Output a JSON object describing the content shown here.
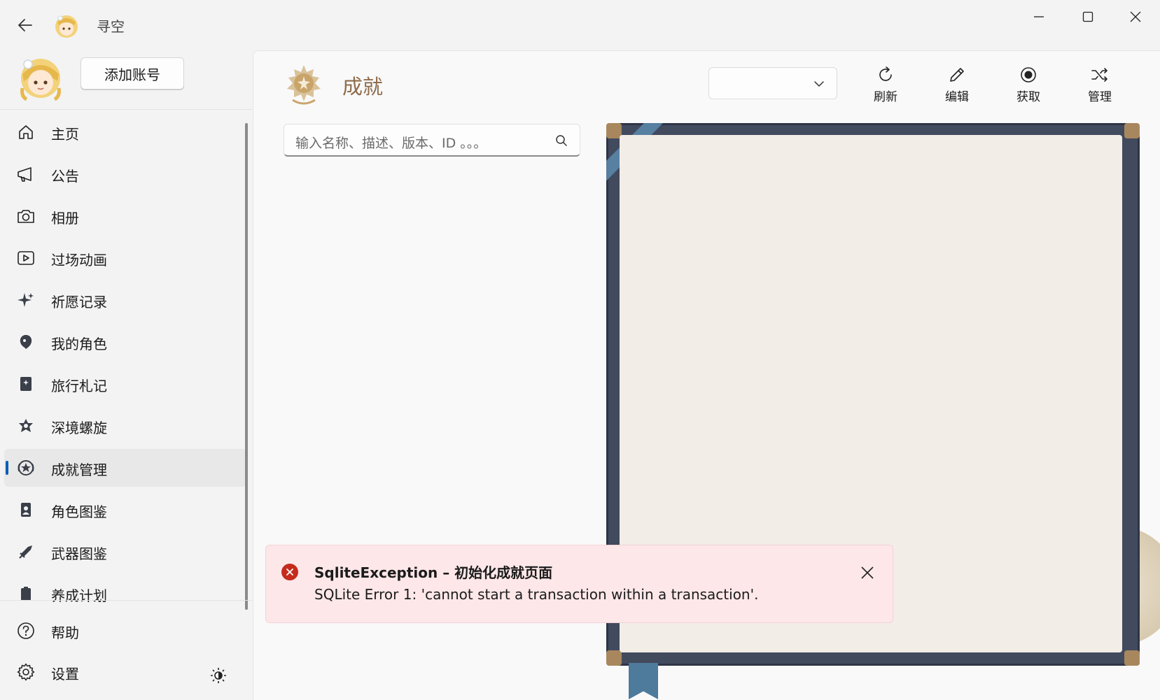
{
  "window": {
    "title": "寻空"
  },
  "account": {
    "add_account_label": "添加账号"
  },
  "sidebar": {
    "items": [
      {
        "label": "主页",
        "icon": "home-icon",
        "selected": false
      },
      {
        "label": "公告",
        "icon": "megaphone-icon",
        "selected": false
      },
      {
        "label": "相册",
        "icon": "camera-icon",
        "selected": false
      },
      {
        "label": "过场动画",
        "icon": "play-icon",
        "selected": false
      },
      {
        "label": "祈愿记录",
        "icon": "sparkle-icon",
        "selected": false
      },
      {
        "label": "我的角色",
        "icon": "character-icon",
        "selected": false
      },
      {
        "label": "旅行札记",
        "icon": "notebook-icon",
        "selected": false
      },
      {
        "label": "深境螺旋",
        "icon": "abyss-icon",
        "selected": false
      },
      {
        "label": "成就管理",
        "icon": "achievement-icon",
        "selected": true
      },
      {
        "label": "角色图鉴",
        "icon": "character-wiki-icon",
        "selected": false
      },
      {
        "label": "武器图鉴",
        "icon": "weapon-wiki-icon",
        "selected": false
      },
      {
        "label": "养成计划",
        "icon": "plan-icon",
        "selected": false
      }
    ],
    "footer": {
      "help_label": "帮助",
      "settings_label": "设置"
    }
  },
  "main": {
    "page_title": "成就",
    "dropdown_value": "",
    "commands": [
      {
        "label": "刷新",
        "icon": "refresh-icon"
      },
      {
        "label": "编辑",
        "icon": "pencil-icon"
      },
      {
        "label": "获取",
        "icon": "record-icon"
      },
      {
        "label": "管理",
        "icon": "shuffle-icon"
      }
    ],
    "search": {
      "placeholder": "输入名称、描述、版本、ID 。。。"
    }
  },
  "infobar": {
    "severity": "error",
    "title": "SqliteException – 初始化成就页面",
    "message": "SQLite Error 1: 'cannot start a transaction within a transaction'.",
    "color": "#c42b1c"
  },
  "colors": {
    "accent": "#0a5fb4",
    "title_gold": "#8f6c4a",
    "error_bg": "#fde7e9"
  }
}
